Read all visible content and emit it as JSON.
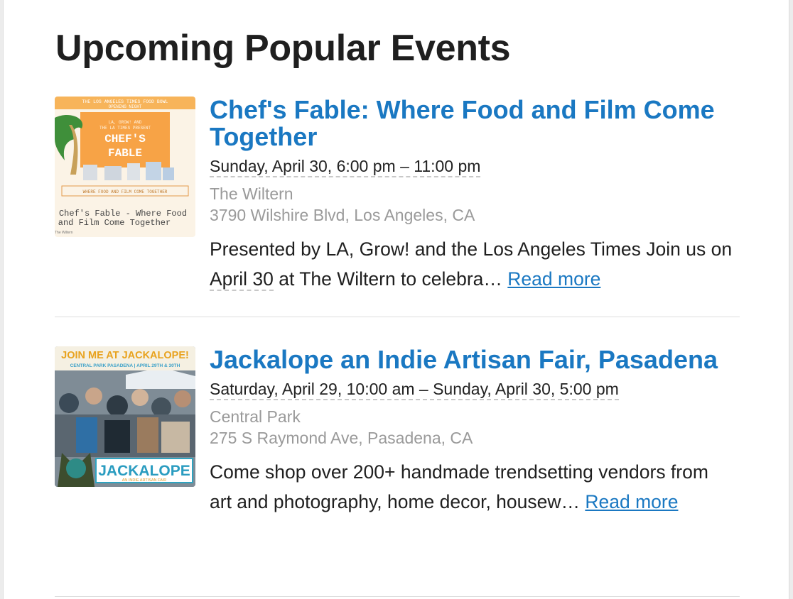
{
  "heading": "Upcoming Popular Events",
  "events": [
    {
      "title": "Chef's Fable: Where Food and Film Come Together",
      "date": "Sunday, April 30, 6:00 pm – 11:00 pm",
      "venue": "The Wiltern",
      "address": "3790 Wilshire Blvd, Los Angeles, CA",
      "desc_start": "Presented by LA, Grow! and the Los Angeles Times Join us on ",
      "desc_abbr": "April 30",
      "desc_end": " at The Wiltern to celebra… ",
      "read_more": "Read more",
      "image": {
        "top_lines": [
          "THE LOS ANGELES TIMES FOOD BOWL",
          "OPENING NIGHT"
        ],
        "presenters": [
          "LA, GROW! AND",
          "THE LA TIMES PRESENT"
        ],
        "logo_lines": [
          "CHEF'S",
          "FABLE"
        ],
        "tagline": "WHERE FOOD AND FILM COME TOGETHER",
        "caption_lines": [
          "Chef's Fable - Where Food",
          "and Film Come Together"
        ],
        "venue": "The Wiltern"
      }
    },
    {
      "title": "Jackalope an Indie Artisan Fair, Pasadena",
      "date": "Saturday, April 29, 10:00 am – Sunday, April 30, 5:00 pm",
      "venue": "Central Park",
      "address": "275 S Raymond Ave, Pasadena, CA",
      "desc_start": "Come shop over 200+ handmade trendsetting vendors from art and photography, home decor, housew… ",
      "read_more": "Read more",
      "image": {
        "banner": "JOIN ME AT JACKALOPE!",
        "subbanner": "CENTRAL PARK PASADENA | APRIL 29TH & 30TH",
        "logo": "JACKALOPE",
        "logo_sub": "AN INDIE ARTISAN FAIR"
      }
    }
  ]
}
